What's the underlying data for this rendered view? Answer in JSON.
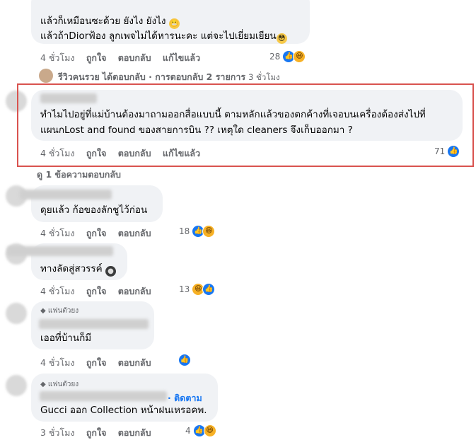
{
  "comment1": {
    "line1": "แล้วก็เหมือนซะด้วย ยังไง ยังไง",
    "line2": "แล้วถ้าDiorฟ้อง ลูกเพจไม่ได้หารนะคะ แต่จะไปเยี่ยมเยียน",
    "time": "4 ชั่วโมง",
    "like": "ถูกใจ",
    "reply": "ตอบกลับ",
    "edited": "แก้ไขแล้ว",
    "reactions": "28"
  },
  "reply_thread": {
    "name": "รีวิวคนรวย",
    "text": "ได้ตอบกลับ · การตอบกลับ 2 รายการ",
    "time": "3 ชั่วโมง"
  },
  "comment2": {
    "line1": "ทำไมไปอยู่ที่แม่บ้านต้องมาถามออกสื่อแบบนี้ ตามหลักแล้วของตกค้างที่เจอบนเครื่องต้องส่งไปที่",
    "line2": "แผนกLost and found ของสายการบิน ?? เหตุใด cleaners จึงเก็บออกมา ?",
    "time": "4 ชั่วโมง",
    "like": "ถูกใจ",
    "reply": "ตอบกลับ",
    "edited": "แก้ไขแล้ว",
    "reactions": "71"
  },
  "view_replies": "ดู 1 ข้อความตอบกลับ",
  "comment3": {
    "text": "ดุยแล้ว ก้อของลักชูไว้ก่อน",
    "time": "4 ชั่วโมง",
    "like": "ถูกใจ",
    "reply": "ตอบกลับ",
    "reactions": "18"
  },
  "comment4": {
    "text": "ทางลัดสู่สวรรค์",
    "time": "4 ชั่วโมง",
    "like": "ถูกใจ",
    "reply": "ตอบกลับ",
    "reactions": "13"
  },
  "comment5": {
    "badge": "แฟนตัวยง",
    "text": "เออที่บ้านก็มี",
    "time": "4 ชั่วโมง",
    "like": "ถูกใจ",
    "reply": "ตอบกลับ"
  },
  "comment6": {
    "badge": "แฟนตัวยง",
    "follow": "· ติดตาม",
    "text": "Gucci ออก Collection หน้าฝนเหรอคพ.",
    "time": "3 ชั่วโมง",
    "like": "ถูกใจ",
    "reply": "ตอบกลับ",
    "reactions": "4"
  },
  "colors": {
    "accent": "#1877f2",
    "highlight": "#d9534f",
    "bubble": "#f0f2f5",
    "meta": "#65676b"
  },
  "icons": [
    "like-icon",
    "haha-icon",
    "diamond-icon",
    "moon-face-icon"
  ]
}
